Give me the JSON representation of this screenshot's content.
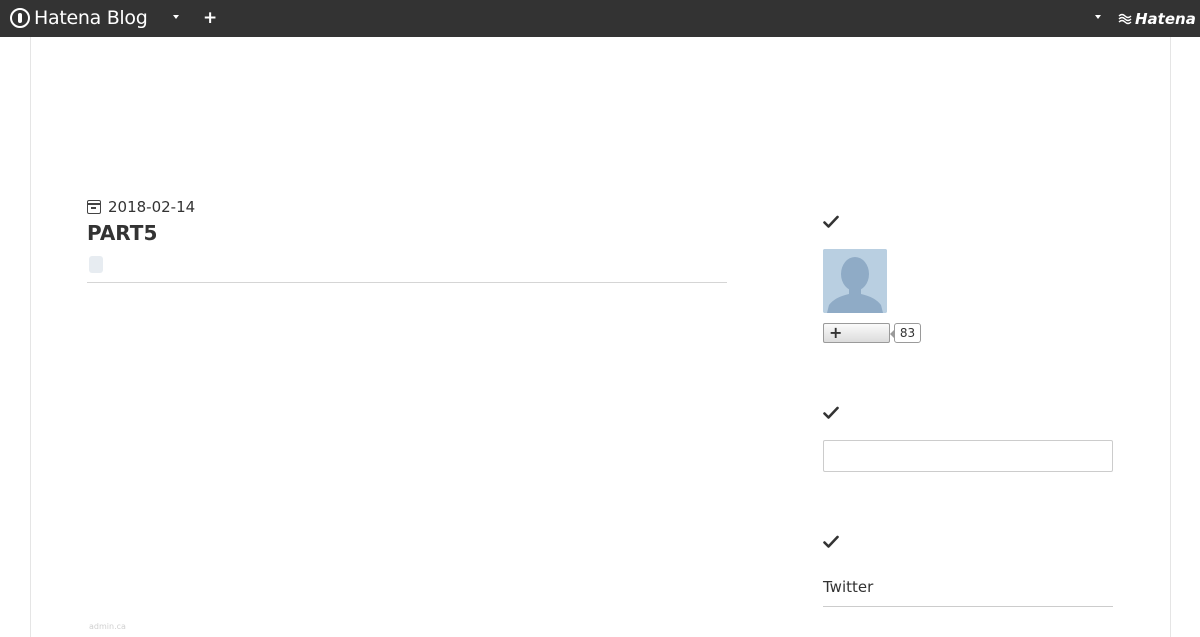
{
  "topbar": {
    "brand": "Hatena Blog",
    "hatena": "Hatena"
  },
  "article": {
    "date": "2018-02-14",
    "title": "PART5",
    "footer_text": "admin.ca"
  },
  "sidebar": {
    "follow_count": "83",
    "follow_plus": "+",
    "search_value": "",
    "links_label": "Twitter"
  },
  "colors": {
    "topbar_bg": "#333333",
    "avatar_bg": "#b9cfe1",
    "text": "#333333"
  }
}
